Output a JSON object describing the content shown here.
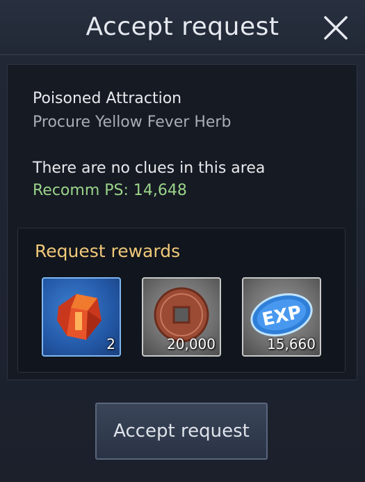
{
  "header": {
    "title": "Accept request",
    "close_icon": "close-icon"
  },
  "quest": {
    "name": "Poisoned Attraction",
    "objective": "Procure Yellow Fever Herb",
    "clue_text": "There are no clues in this area",
    "recommended_ps": "Recomm PS: 14,648"
  },
  "rewards": {
    "title": "Request rewards",
    "items": [
      {
        "icon": "red-crystal-icon",
        "count": "2"
      },
      {
        "icon": "coin-icon",
        "count": "20,000"
      },
      {
        "icon": "exp-icon",
        "count": "15,660"
      }
    ]
  },
  "footer": {
    "accept_label": "Accept request"
  },
  "colors": {
    "accent_gold": "#f0c97a",
    "ps_green": "#9bd48a"
  }
}
